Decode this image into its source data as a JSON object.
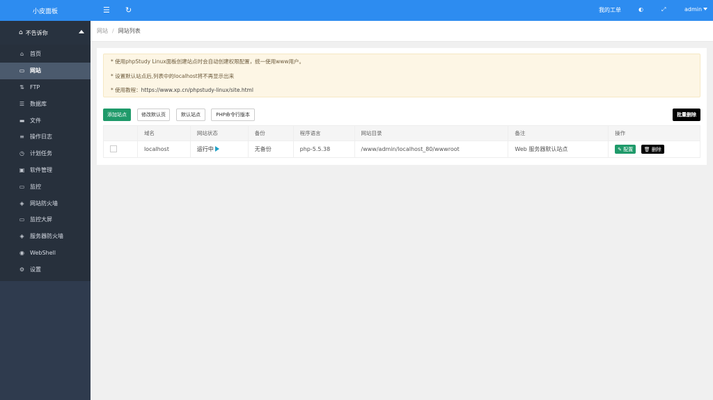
{
  "brand": "小皮面板",
  "sidebar": {
    "group_label": "不告诉你",
    "items": [
      {
        "label": "首页",
        "icon": "home-icon",
        "glyph": "⌂"
      },
      {
        "label": "网站",
        "icon": "monitor-icon",
        "glyph": "▭"
      },
      {
        "label": "FTP",
        "icon": "ftp-icon",
        "glyph": "⇅"
      },
      {
        "label": "数据库",
        "icon": "database-icon",
        "glyph": "☰"
      },
      {
        "label": "文件",
        "icon": "folder-icon",
        "glyph": "▬"
      },
      {
        "label": "操作日志",
        "icon": "log-icon",
        "glyph": "≡"
      },
      {
        "label": "计划任务",
        "icon": "clock-icon",
        "glyph": "◷"
      },
      {
        "label": "软件管理",
        "icon": "software-icon",
        "glyph": "▣"
      },
      {
        "label": "监控",
        "icon": "monitor-chart-icon",
        "glyph": "▭"
      },
      {
        "label": "网站防火墙",
        "icon": "shield-icon",
        "glyph": "◈"
      },
      {
        "label": "监控大屏",
        "icon": "screen-icon",
        "glyph": "▭"
      },
      {
        "label": "服务器防火墙",
        "icon": "server-shield-icon",
        "glyph": "◈"
      },
      {
        "label": "WebShell",
        "icon": "webshell-icon",
        "glyph": "◉"
      },
      {
        "label": "设置",
        "icon": "gear-icon",
        "glyph": "⚙"
      }
    ]
  },
  "topbar": {
    "menu_toggle_icon": "menu-toggle-icon",
    "refresh_icon": "refresh-icon",
    "my_tickets": "我的工单",
    "user": "admin"
  },
  "breadcrumb": {
    "root": "网站",
    "current": "网站列表"
  },
  "notice": {
    "line1": "* 使用phpStudy Linux面板创建站点时会自动创建权限配置，统一使用www用户。",
    "line2": "* 设置默认站点后,列表中的localhost将不再显示出来",
    "line3_prefix": "* 使用教程：",
    "line3_link": "https://www.xp.cn/phpstudy-linux/site.html"
  },
  "toolbar": {
    "add_site": "添加站点",
    "edit_default_page": "修改默认页",
    "default_site": "默认站点",
    "php_cli_version": "PHP命令行版本",
    "bulk_delete": "批量删除"
  },
  "table": {
    "headers": [
      "",
      "域名",
      "网站状态",
      "备份",
      "程序语言",
      "网站目录",
      "备注",
      "操作"
    ],
    "rows": [
      {
        "domain": "localhost",
        "status": "运行中",
        "backup": "无备份",
        "language": "php-5.5.38",
        "directory": "/www/admin/localhost_80/wwwroot",
        "remark": "Web 服务器默认站点",
        "config_label": "配置",
        "delete_label": "删除"
      }
    ]
  },
  "colors": {
    "accent": "#2d8cf0",
    "sidebar": "#2f3b4e",
    "green": "#1f9a6a",
    "notice_bg": "#fdf6e5"
  }
}
